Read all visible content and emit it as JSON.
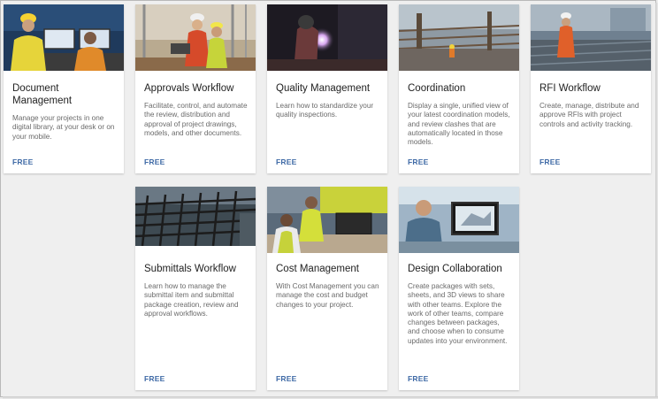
{
  "cards": [
    {
      "title": "Document Management",
      "desc": "Manage your projects in one digital library, at your desk or on your mobile.",
      "price": "FREE"
    },
    {
      "title": "Approvals Workflow",
      "desc": "Facilitate, control, and automate the review, distribution and approval of project drawings, models, and other documents.",
      "price": "FREE"
    },
    {
      "title": "Quality Management",
      "desc": "Learn how to standardize your quality inspections.",
      "price": "FREE"
    },
    {
      "title": "Coordination",
      "desc": "Display a single, unified view of your latest coordination models, and review clashes that are automatically located in those models.",
      "price": "FREE"
    },
    {
      "title": "RFI Workflow",
      "desc": "Create, manage, distribute and approve RFIs with project controls and activity tracking.",
      "price": "FREE"
    },
    {
      "title": "Submittals Workflow",
      "desc": "Learn how to manage the submittal item and submittal package creation, review and approval workflows.",
      "price": "FREE"
    },
    {
      "title": "Cost Management",
      "desc": "With Cost Management you can manage the cost and budget changes to your project.",
      "price": "FREE"
    },
    {
      "title": "Design Collaboration",
      "desc": "Create packages with sets, sheets, and 3D views to share with other teams. Explore the work of other teams, compare changes between packages, and choose when to consume updates into your environment.",
      "price": "FREE"
    }
  ]
}
